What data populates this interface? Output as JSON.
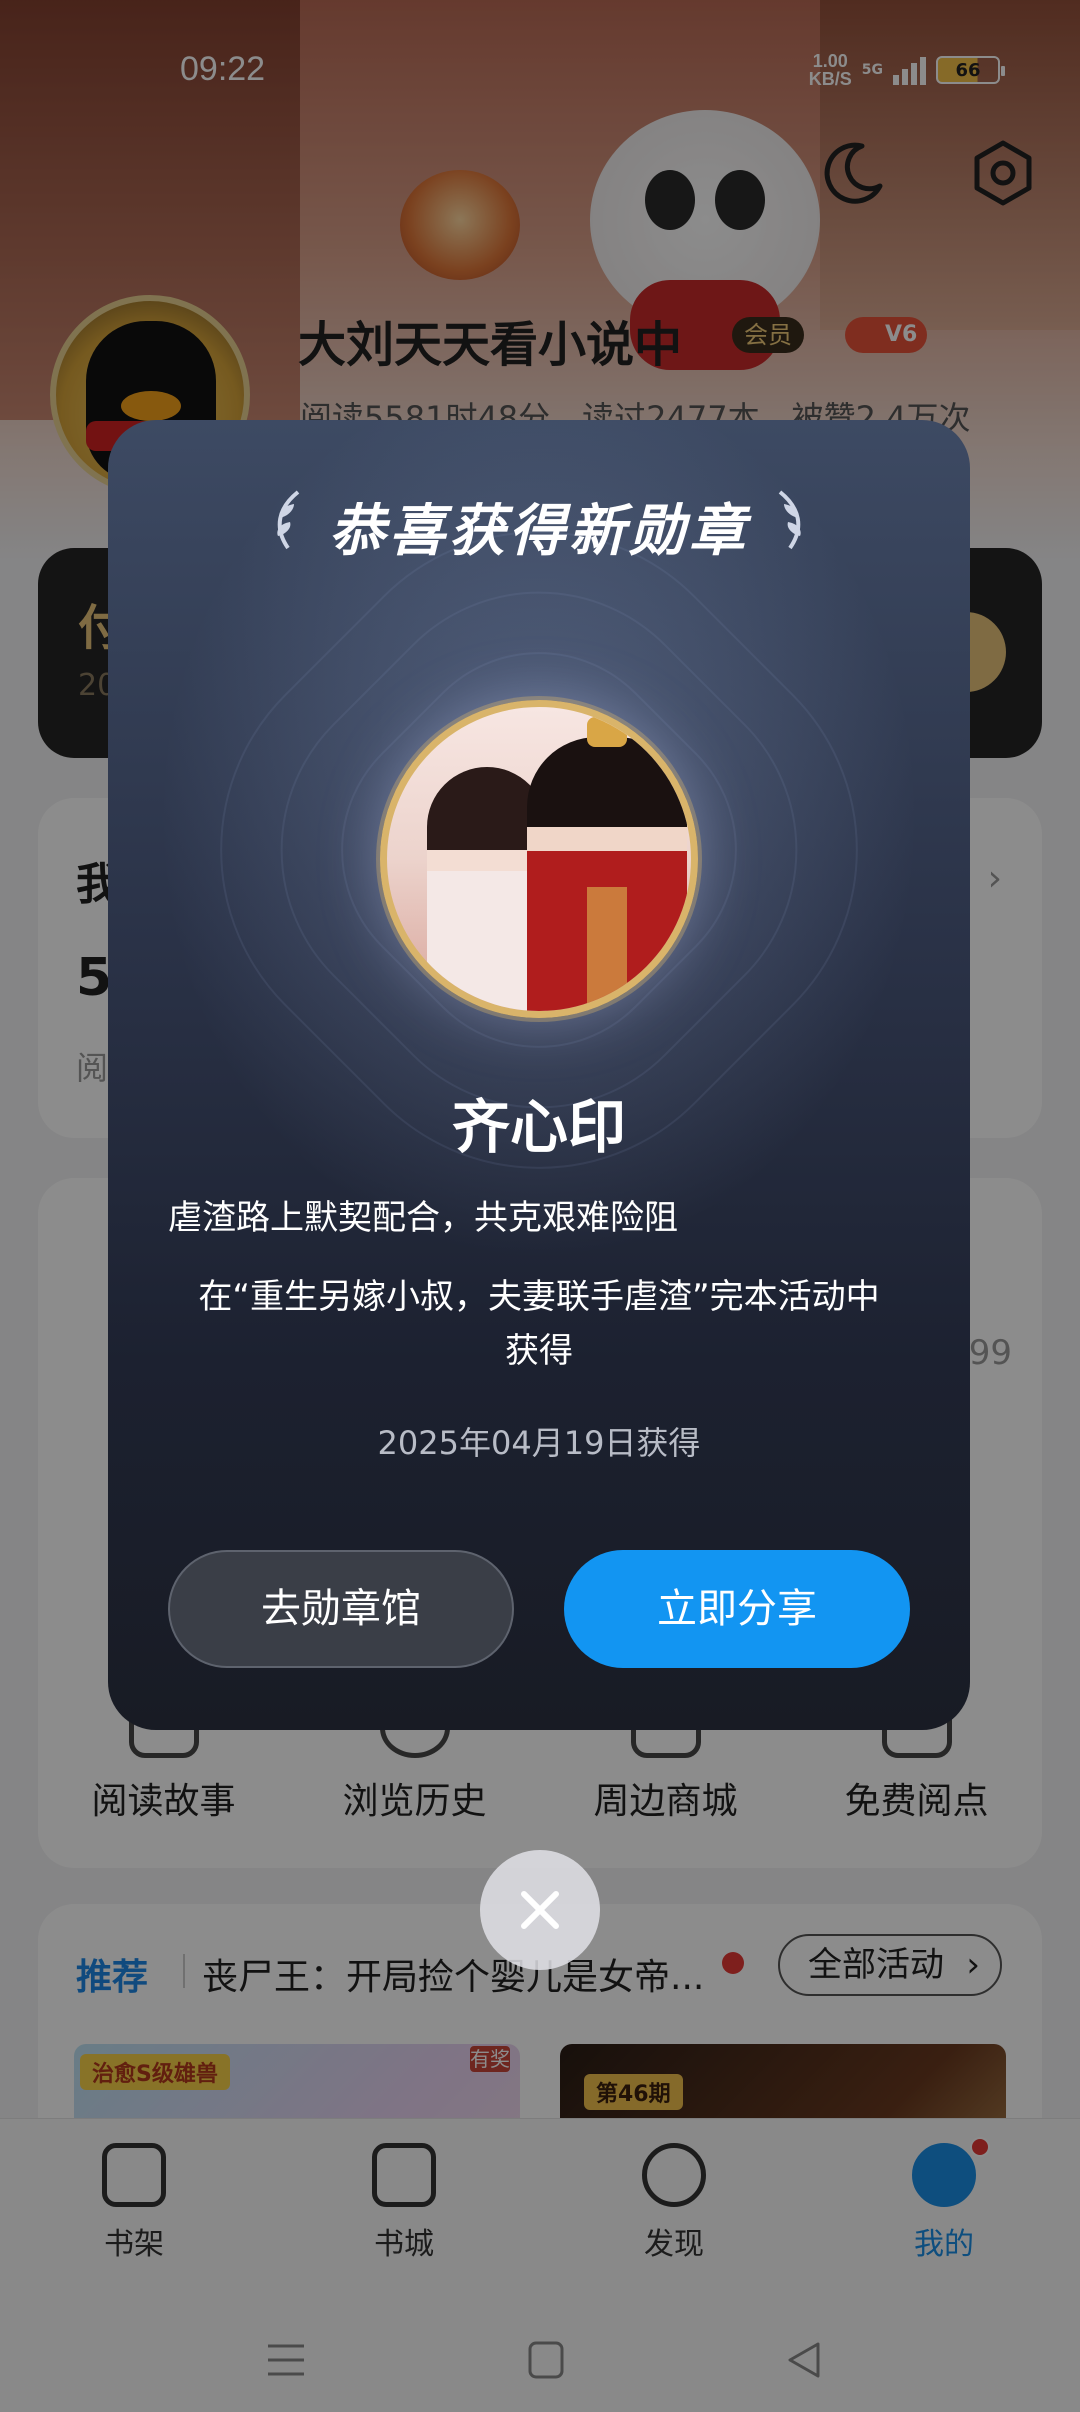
{
  "status_bar": {
    "time": "09:22",
    "net_speed_value": "1.00",
    "net_speed_unit": "KB/S",
    "signal_label": "5G",
    "battery": "66"
  },
  "profile": {
    "nickname": "大刘天天看小说中",
    "vip_badge": "会员",
    "level_badge": "V6",
    "stats_line": "阅读5581时48分，读过2477本，被赞2.4万次"
  },
  "background_cards": {
    "vip_partial_title": "付",
    "vip_partial_sub": "20",
    "reading_partial_title": "我",
    "reading_partial_value": "55",
    "reading_partial_sub": "阅",
    "partial_count": "99"
  },
  "tools": [
    {
      "label": "阅读故事",
      "icon": "story-icon"
    },
    {
      "label": "浏览历史",
      "icon": "history-icon"
    },
    {
      "label": "周边商城",
      "icon": "shop-icon"
    },
    {
      "label": "免费阅点",
      "icon": "free-points-icon"
    }
  ],
  "promo": {
    "tag": "推荐",
    "title": "丧尸王：开局捡个婴儿是女帝...",
    "all_label": "全部活动",
    "image1_tag": "治愈S级雄兽",
    "image1_corner": "有奖",
    "image2_tag": "第46期"
  },
  "tabbar": [
    {
      "label": "书架",
      "icon": "bookshelf-icon",
      "active": false
    },
    {
      "label": "书城",
      "icon": "bookstore-icon",
      "active": false
    },
    {
      "label": "发现",
      "icon": "discover-icon",
      "active": false
    },
    {
      "label": "我的",
      "icon": "profile-icon",
      "active": true
    }
  ],
  "modal": {
    "title": "恭喜获得新勋章",
    "medal_name": "齐心印",
    "medal_description": "虐渣路上默契配合，共克艰难险阻",
    "medal_source_line1": "在“重生另嫁小叔，夫妻联手虐渣”完本活动中",
    "medal_source_line2": "获得",
    "obtained_date": "2025年04月19日获得",
    "hall_button": "去勋章馆",
    "share_button": "立即分享"
  },
  "colors": {
    "accent_blue": "#1295f2",
    "modal_bg_top": "#3d4a63",
    "modal_bg_bottom": "#181b24",
    "medal_gold": "#d9b46a",
    "notification_red": "#e53935"
  }
}
